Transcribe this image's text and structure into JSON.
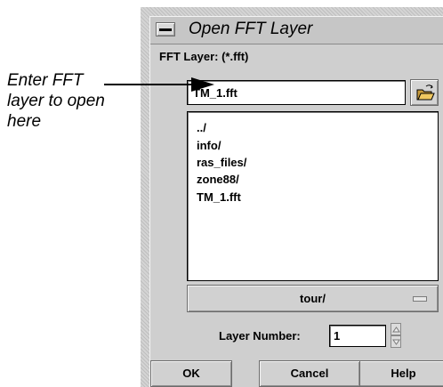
{
  "callout": {
    "lines": [
      "Enter FFT",
      "layer to open",
      "here"
    ]
  },
  "dialog": {
    "title": "Open FFT Layer",
    "window_menu_icon": "window-menu-icon",
    "filter_label": "FFT Layer: (*.fft)",
    "filename_value": "TM_1.fft",
    "folder_icon": "open-folder-icon",
    "file_list": [
      "../",
      "info/",
      "ras_files/",
      "zone88/",
      "TM_1.fft"
    ],
    "directory": "tour/",
    "layer_number_label": "Layer Number:",
    "layer_number_value": "1",
    "buttons": {
      "ok": "OK",
      "cancel": "Cancel",
      "help": "Help"
    }
  },
  "colors": {
    "dialog_bg": "#cfcfcf",
    "arrow": "#000000"
  }
}
